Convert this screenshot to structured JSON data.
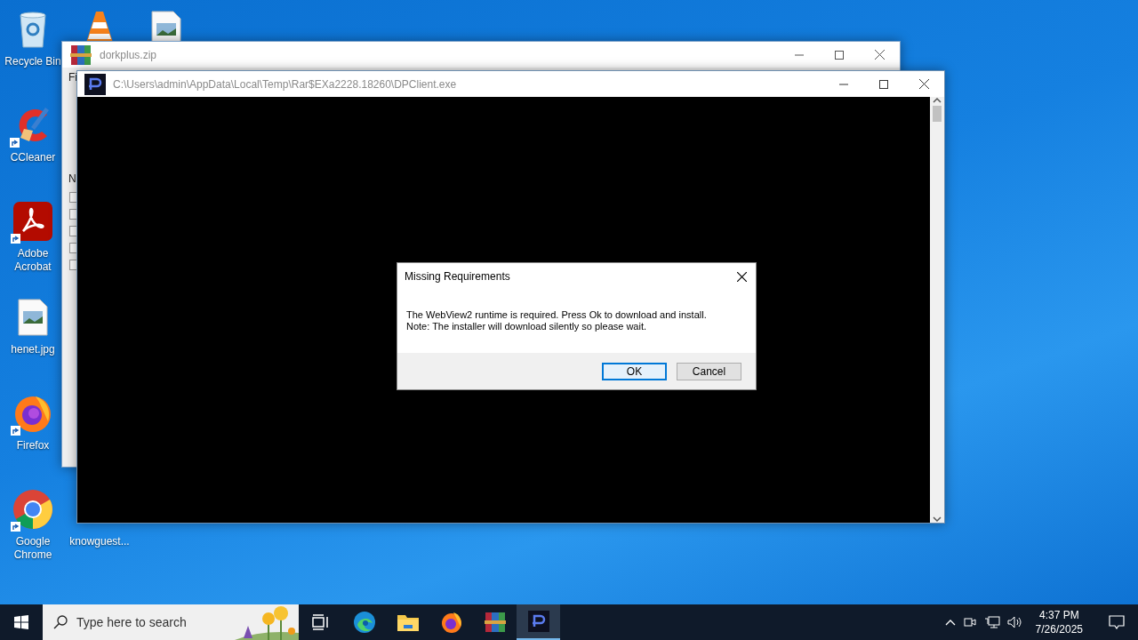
{
  "desktop_icons": [
    {
      "label": "Recycle Bin",
      "kind": "recycle",
      "shortcut": false
    },
    {
      "label": "CCleaner",
      "kind": "ccleaner",
      "shortcut": true
    },
    {
      "label": "Adobe Acrobat",
      "kind": "acrobat",
      "shortcut": true
    },
    {
      "label": "henet.jpg",
      "kind": "image",
      "shortcut": false
    },
    {
      "label": "Firefox",
      "kind": "firefox",
      "shortcut": true
    },
    {
      "label": "Google Chrome",
      "kind": "chrome",
      "shortcut": true
    },
    {
      "kind": "vlc"
    },
    {
      "kind": "image",
      "shortcut": false
    },
    {
      "label": "knowguest..."
    }
  ],
  "archive_window": {
    "title": "dorkplus.zip",
    "menu_fragment": "Fi",
    "column_fragment": "N"
  },
  "client_window": {
    "title": "C:\\Users\\admin\\AppData\\Local\\Temp\\Rar$EXa2228.18260\\DPClient.exe"
  },
  "dialog": {
    "title": "Missing Requirements",
    "message_lines": [
      "The WebView2 runtime is required. Press Ok to download and install.",
      "Note: The installer will download silently so please wait."
    ],
    "buttons": [
      {
        "label": "OK",
        "focused": true
      },
      {
        "label": "Cancel",
        "focused": false
      }
    ]
  },
  "taskbar": {
    "search": {
      "placeholder": "Type here to search"
    },
    "apps": [
      {
        "kind": "taskview",
        "selected": false
      },
      {
        "kind": "edge",
        "selected": false
      },
      {
        "kind": "explorer",
        "selected": false
      },
      {
        "kind": "firefox",
        "selected": false
      },
      {
        "kind": "winrar",
        "selected": false
      },
      {
        "kind": "dpclient",
        "selected": true
      }
    ],
    "time": "4:37 PM",
    "date": "7/26/2025"
  }
}
